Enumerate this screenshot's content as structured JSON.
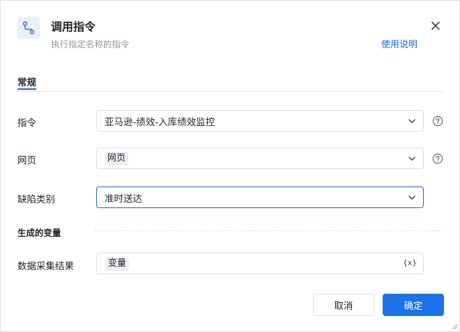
{
  "dialog": {
    "title": "调用指令",
    "subtitle": "执行指定名称的指令",
    "help_link": "使用说明",
    "icon": "flow-connector-icon"
  },
  "tabs": [
    {
      "label": "常规",
      "active": true
    }
  ],
  "fields": {
    "command": {
      "label": "指令",
      "value": "亚马逊-绩效-入库绩效监控"
    },
    "webpage": {
      "label": "网页",
      "value": "网页"
    },
    "defect_type": {
      "label": "缺陷类别",
      "value": "准时送达"
    }
  },
  "output_section": {
    "title": "生成的变量",
    "result": {
      "label": "数据采集结果",
      "value": "变量",
      "var_button": "{x}"
    }
  },
  "buttons": {
    "cancel": "取消",
    "ok": "确定"
  },
  "colors": {
    "accent": "#1a73e8",
    "link": "#1a66d9"
  }
}
